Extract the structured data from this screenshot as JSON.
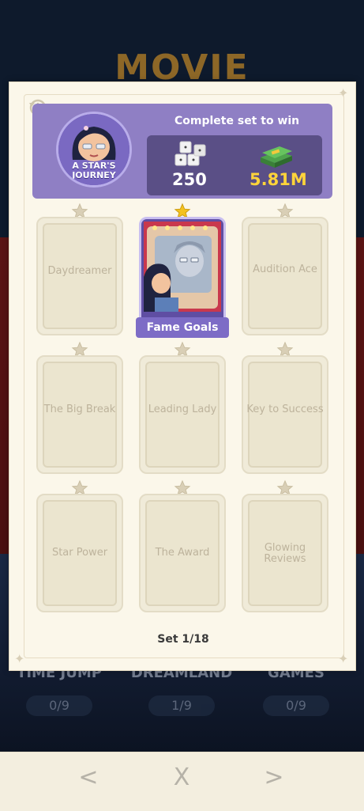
{
  "background": {
    "event_title": "MOVIE",
    "sets": [
      {
        "name": "TIME JUMP",
        "count": "0/9"
      },
      {
        "name": "DREAMLAND",
        "count": "1/9"
      },
      {
        "name": "GAMES",
        "count": "0/9"
      }
    ]
  },
  "header": {
    "prompt": "Complete set to win",
    "set_name_line1": "A STAR'S",
    "set_name_line2": "JOURNEY",
    "reward_dice": "250",
    "reward_cash": "5.81M",
    "colors": {
      "header_bg": "#8f7fc4",
      "rewards_bg": "#5a4f86",
      "cash_text": "#ffd43a"
    }
  },
  "cards": [
    {
      "name": "Daydreamer",
      "collected": false
    },
    {
      "name": "Fame Goals",
      "collected": true
    },
    {
      "name": "Audition Ace",
      "collected": false
    },
    {
      "name": "The Big Break",
      "collected": false
    },
    {
      "name": "Leading Lady",
      "collected": false
    },
    {
      "name": "Key to Success",
      "collected": false
    },
    {
      "name": "Star Power",
      "collected": false
    },
    {
      "name": "The Award",
      "collected": false
    },
    {
      "name": "Glowing Reviews",
      "collected": false
    }
  ],
  "footer": {
    "set_counter": "Set 1/18"
  },
  "nav": {
    "prev": "<",
    "close": "X",
    "next": ">"
  },
  "icons": [
    "history-icon",
    "dice-icon",
    "cash-stack-icon",
    "star-icon",
    "chevron-left-icon",
    "close-icon",
    "chevron-right-icon"
  ]
}
